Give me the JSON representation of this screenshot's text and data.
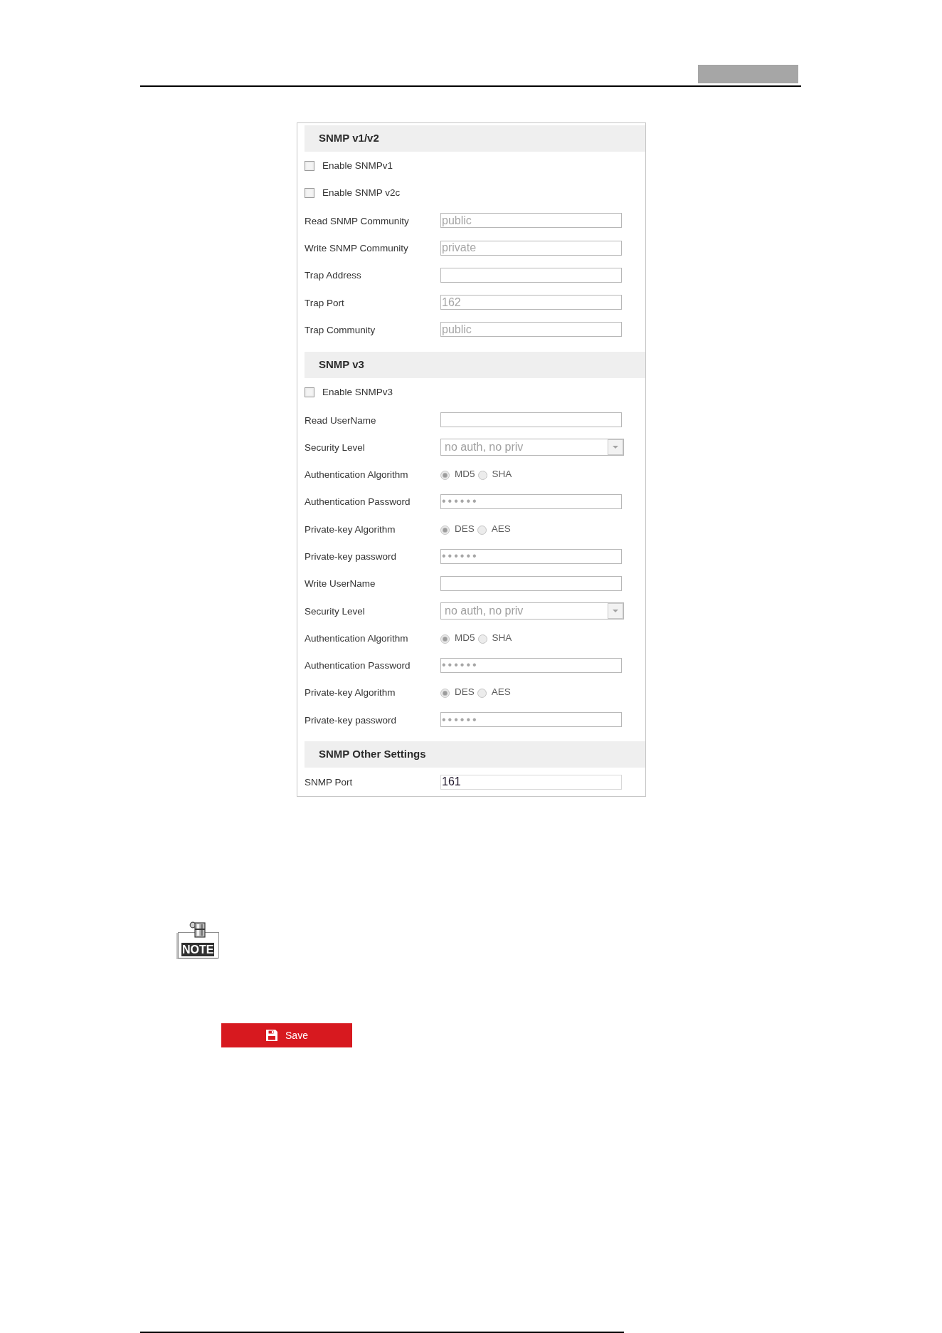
{
  "sections": [
    {
      "title": "SNMP v1/v2",
      "rows": [
        {
          "kind": "checkbox",
          "label": "Enable SNMPv1",
          "checked": false,
          "disabled": false
        },
        {
          "kind": "checkbox",
          "label": "Enable SNMP v2c",
          "checked": false,
          "disabled": false
        },
        {
          "kind": "text",
          "label": "Read SNMP Community",
          "value": "public",
          "disabled": true
        },
        {
          "kind": "text",
          "label": "Write SNMP Community",
          "value": "private",
          "disabled": true
        },
        {
          "kind": "text",
          "label": "Trap Address",
          "disabled": true
        },
        {
          "kind": "text",
          "label": "Trap Port",
          "value": "162",
          "disabled": true
        },
        {
          "kind": "text",
          "label": "Trap Community",
          "value": "public",
          "disabled": true
        }
      ]
    },
    {
      "title": "SNMP v3",
      "rows": [
        {
          "kind": "checkbox",
          "label": "Enable SNMPv3",
          "checked": false,
          "disabled": false
        },
        {
          "kind": "text",
          "label": "Read UserName",
          "disabled": true
        },
        {
          "kind": "select",
          "label": "Security Level",
          "value": "no auth, no priv",
          "disabled": true
        },
        {
          "kind": "radio",
          "label": "Authentication Algorithm",
          "disabled": true,
          "options": [
            {
              "label": "MD5",
              "selected": true
            },
            {
              "label": "SHA",
              "selected": false
            }
          ]
        },
        {
          "kind": "password",
          "label": "Authentication Password",
          "value": "••••••",
          "disabled": true
        },
        {
          "kind": "radio",
          "label": "Private-key Algorithm",
          "disabled": true,
          "options": [
            {
              "label": "DES",
              "selected": true
            },
            {
              "label": "AES",
              "selected": false
            }
          ]
        },
        {
          "kind": "password",
          "label": "Private-key password",
          "value": "••••••",
          "disabled": true
        },
        {
          "kind": "text",
          "label": "Write UserName",
          "disabled": true
        },
        {
          "kind": "select",
          "label": "Security Level",
          "value": "no auth, no priv",
          "disabled": true
        },
        {
          "kind": "radio",
          "label": "Authentication Algorithm",
          "disabled": true,
          "options": [
            {
              "label": "MD5",
              "selected": true
            },
            {
              "label": "SHA",
              "selected": false
            }
          ]
        },
        {
          "kind": "password",
          "label": "Authentication Password",
          "value": "••••••",
          "disabled": true
        },
        {
          "kind": "radio",
          "label": "Private-key Algorithm",
          "disabled": true,
          "options": [
            {
              "label": "DES",
              "selected": true
            },
            {
              "label": "AES",
              "selected": false
            }
          ]
        },
        {
          "kind": "password",
          "label": "Private-key password",
          "value": "••••••",
          "disabled": true
        }
      ]
    },
    {
      "title": "SNMP Other Settings",
      "rows": [
        {
          "kind": "text",
          "label": "SNMP Port",
          "value": "161",
          "disabled": false
        }
      ]
    }
  ],
  "note": {
    "label": "NOTE"
  },
  "save_button": {
    "label": "Save"
  }
}
